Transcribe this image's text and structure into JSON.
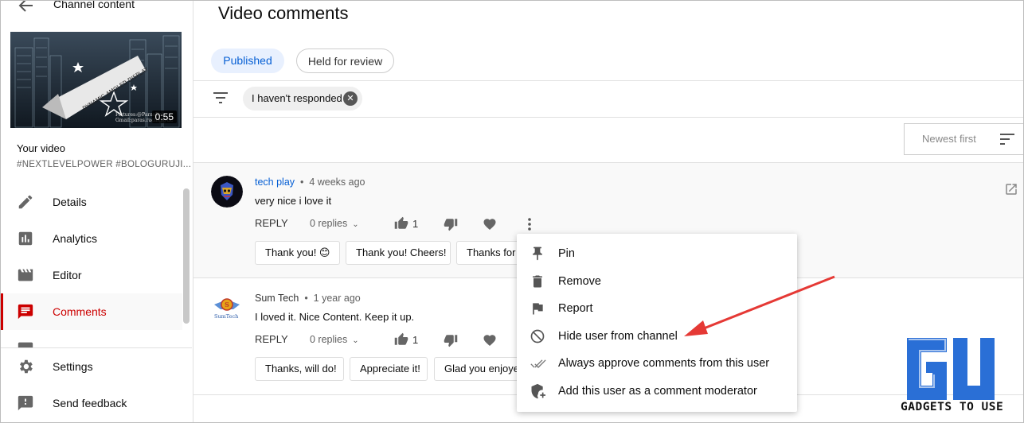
{
  "sidebar": {
    "back_label": "Channel content",
    "thumbnail": {
      "banner_text": "DYNAMIC AMOLED DISPLAY",
      "credit_text": "Pictures:@ParasRai Gmail:paras.racing@Gc",
      "duration": "0:55"
    },
    "your_video_label": "Your video",
    "video_tags": "#NEXTLEVELPOWER #BOLOGURUJI...",
    "items": [
      {
        "label": "Details",
        "icon": "pencil-icon"
      },
      {
        "label": "Analytics",
        "icon": "analytics-icon"
      },
      {
        "label": "Editor",
        "icon": "clapperboard-icon"
      },
      {
        "label": "Comments",
        "icon": "comments-icon",
        "active": true
      }
    ],
    "bottom_items": [
      {
        "label": "Settings",
        "icon": "gear-icon"
      },
      {
        "label": "Send feedback",
        "icon": "feedback-icon"
      }
    ]
  },
  "main": {
    "title": "Video comments",
    "tabs": [
      {
        "label": "Published",
        "selected": true
      },
      {
        "label": "Held for review",
        "selected": false
      }
    ],
    "filter_chip": "I haven't responded",
    "sort_label": "Newest first"
  },
  "comments": [
    {
      "author": "tech play",
      "time": "4 weeks ago",
      "text": "very nice i love it",
      "reply_label": "REPLY",
      "replies_label": "0 replies",
      "likes": "1",
      "quick_replies": [
        "Thank you! 😊",
        "Thank you! Cheers!",
        "Thanks for"
      ]
    },
    {
      "author": "Sum Tech",
      "avatar_text": "SumTech",
      "time": "1 year ago",
      "text": "I loved it. Nice Content. Keep it up.",
      "reply_label": "REPLY",
      "replies_label": "0 replies",
      "likes": "1",
      "quick_replies": [
        "Thanks, will do!",
        "Appreciate it!",
        "Glad you enjoyed"
      ]
    }
  ],
  "menu": {
    "items": [
      {
        "label": "Pin",
        "icon": "pin-icon"
      },
      {
        "label": "Remove",
        "icon": "trash-icon"
      },
      {
        "label": "Report",
        "icon": "flag-icon"
      },
      {
        "label": "Hide user from channel",
        "icon": "block-icon"
      },
      {
        "label": "Always approve comments from this user",
        "icon": "double-check-icon"
      },
      {
        "label": "Add this user as a comment moderator",
        "icon": "shield-add-icon"
      }
    ]
  },
  "watermark": {
    "text": "GADGETS TO USE",
    "logo": "gu-logo"
  },
  "colors": {
    "accent_red": "#cc0000",
    "link_blue": "#065fd4",
    "arrow_red": "#e53935",
    "tab_bg": "#e8f0fe"
  }
}
